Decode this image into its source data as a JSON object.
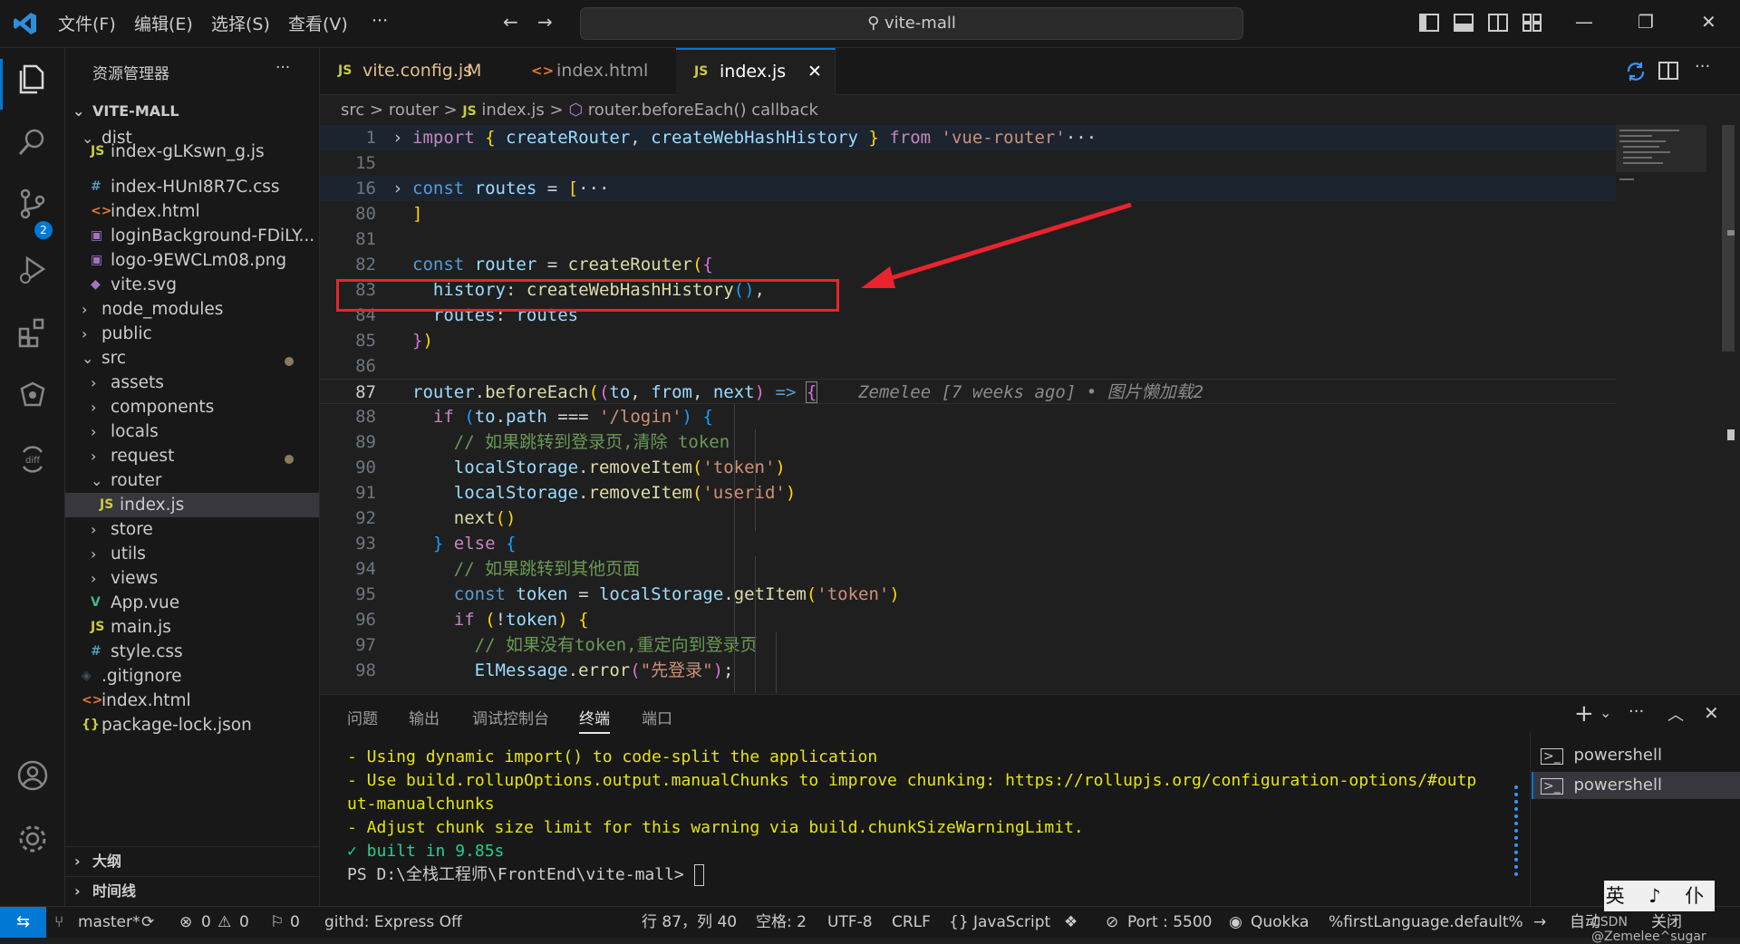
{
  "titlebar": {
    "menus": [
      "文件(F)",
      "编辑(E)",
      "选择(S)",
      "查看(V)",
      "···"
    ],
    "search_text": "vite-mall"
  },
  "activity_bar": {
    "scm_badge": "2"
  },
  "explorer": {
    "title": "资源管理器",
    "more": "···",
    "root": "VITE-MALL",
    "items": [
      {
        "label": "dist",
        "kind": "folder-open"
      },
      {
        "label": "index-gLKswn_g.js",
        "kind": "js"
      },
      {
        "label": "index-HUnI8R7C.css",
        "kind": "css"
      },
      {
        "label": "index.html",
        "kind": "html"
      },
      {
        "label": "loginBackground-FDiLY...",
        "kind": "img"
      },
      {
        "label": "logo-9EWCLm08.png",
        "kind": "img"
      },
      {
        "label": "vite.svg",
        "kind": "svg"
      },
      {
        "label": "node_modules",
        "kind": "folder"
      },
      {
        "label": "public",
        "kind": "folder"
      },
      {
        "label": "src",
        "kind": "folder-open"
      },
      {
        "label": "assets",
        "kind": "folder"
      },
      {
        "label": "components",
        "kind": "folder"
      },
      {
        "label": "locals",
        "kind": "folder"
      },
      {
        "label": "request",
        "kind": "folder"
      },
      {
        "label": "router",
        "kind": "folder-open"
      },
      {
        "label": "index.js",
        "kind": "js"
      },
      {
        "label": "store",
        "kind": "folder"
      },
      {
        "label": "utils",
        "kind": "folder"
      },
      {
        "label": "views",
        "kind": "folder"
      },
      {
        "label": "App.vue",
        "kind": "vue"
      },
      {
        "label": "main.js",
        "kind": "js"
      },
      {
        "label": "style.css",
        "kind": "css"
      },
      {
        "label": ".gitignore",
        "kind": "git"
      },
      {
        "label": "index.html",
        "kind": "html"
      },
      {
        "label": "package-lock.json",
        "kind": "json"
      }
    ],
    "outline": "大纲",
    "timeline": "时间线"
  },
  "tabs": [
    {
      "icon": "JS",
      "label": "vite.config.js",
      "badge": "M"
    },
    {
      "icon": "<>",
      "label": "index.html",
      "badge": ""
    },
    {
      "icon": "JS",
      "label": "index.js",
      "badge": "✕"
    }
  ],
  "breadcrumb": {
    "parts": [
      "src",
      "router",
      "index.js",
      "router.beforeEach() callback"
    ],
    "sep": ">",
    "js_icon": "JS"
  },
  "editor": {
    "line_numbers": [
      "1",
      "15",
      "16",
      "80",
      "81",
      "82",
      "83",
      "84",
      "85",
      "86",
      "87",
      "88",
      "89",
      "90",
      "91",
      "92",
      "93",
      "94",
      "95",
      "96",
      "97",
      "98"
    ],
    "blame": "Zemelee [7 weeks ago] • 图片懒加载2"
  },
  "panel": {
    "tabs": [
      "问题",
      "输出",
      "调试控制台",
      "终端",
      "端口"
    ],
    "terminal_lines": [
      "- Using dynamic import() to code-split the application",
      "- Use build.rollupOptions.output.manualChunks to improve chunking: https://rollupjs.org/configuration-options/#outp",
      "ut-manualchunks",
      "- Adjust chunk size limit for this warning via build.chunkSizeWarningLimit.",
      "✓ built in 9.85s",
      "PS D:\\全栈工程师\\FrontEnd\\vite-mall> "
    ],
    "shells": [
      "powershell",
      "powershell"
    ]
  },
  "statusbar": {
    "branch": "master*",
    "errors": "0",
    "warnings": "0",
    "ports_count": "0",
    "githd": "githd: Express Off",
    "position": "行 87，列 40",
    "spaces": "空格: 2",
    "encoding": "UTF-8",
    "eol": "CRLF",
    "language": "JavaScript",
    "port": "Port : 5500",
    "quokka": "Quokka",
    "first_language": "%firstLanguage.default%",
    "auto": "自动",
    "close": "关闭"
  },
  "ime": "英 ♪ 仆",
  "watermark": "CSDN @Zemelee^sugar"
}
